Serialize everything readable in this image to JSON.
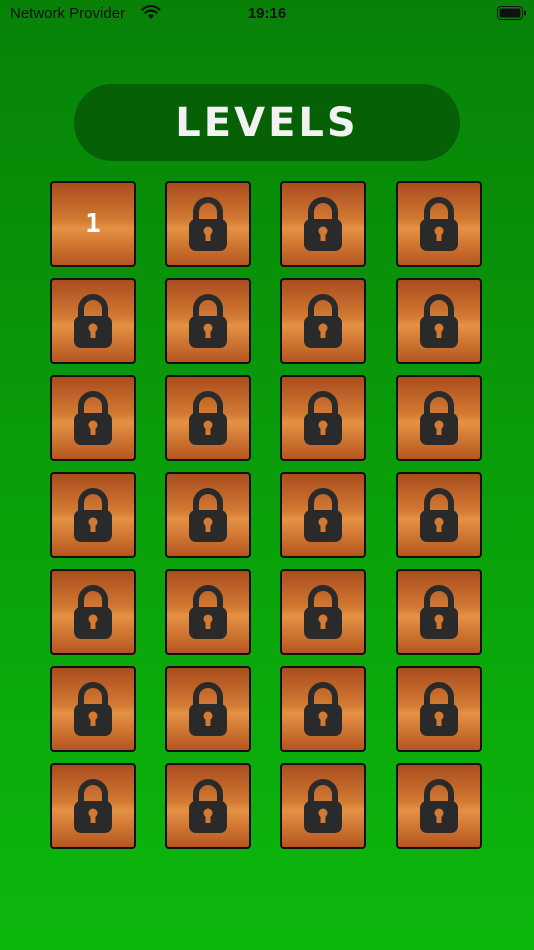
{
  "status_bar": {
    "carrier": "Network Provider",
    "time": "19:16",
    "icons": [
      "wifi-icon",
      "battery-icon"
    ]
  },
  "header": {
    "title": "LEVELS"
  },
  "colors": {
    "background_top": "#078207",
    "background_bottom": "#0cb80c",
    "title_pill": "#066006",
    "tile_light": "#e59244",
    "tile_dark": "#a94d1e",
    "lock": "#2a2a2a"
  },
  "levels": [
    {
      "label": "1",
      "locked": false
    },
    {
      "label": "",
      "locked": true
    },
    {
      "label": "",
      "locked": true
    },
    {
      "label": "",
      "locked": true
    },
    {
      "label": "",
      "locked": true
    },
    {
      "label": "",
      "locked": true
    },
    {
      "label": "",
      "locked": true
    },
    {
      "label": "",
      "locked": true
    },
    {
      "label": "",
      "locked": true
    },
    {
      "label": "",
      "locked": true
    },
    {
      "label": "",
      "locked": true
    },
    {
      "label": "",
      "locked": true
    },
    {
      "label": "",
      "locked": true
    },
    {
      "label": "",
      "locked": true
    },
    {
      "label": "",
      "locked": true
    },
    {
      "label": "",
      "locked": true
    },
    {
      "label": "",
      "locked": true
    },
    {
      "label": "",
      "locked": true
    },
    {
      "label": "",
      "locked": true
    },
    {
      "label": "",
      "locked": true
    },
    {
      "label": "",
      "locked": true
    },
    {
      "label": "",
      "locked": true
    },
    {
      "label": "",
      "locked": true
    },
    {
      "label": "",
      "locked": true
    },
    {
      "label": "",
      "locked": true
    },
    {
      "label": "",
      "locked": true
    },
    {
      "label": "",
      "locked": true
    },
    {
      "label": "",
      "locked": true
    }
  ]
}
